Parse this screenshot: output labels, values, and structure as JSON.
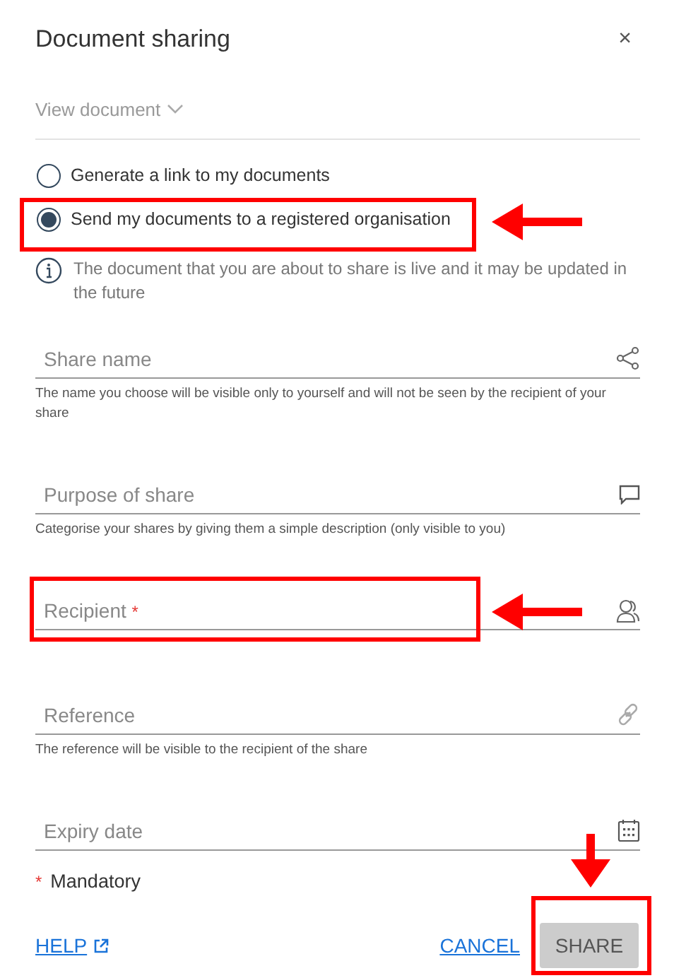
{
  "dialog": {
    "title": "Document sharing",
    "close": "×"
  },
  "view_document": "View document",
  "options": [
    {
      "label": "Generate a link to my documents",
      "selected": false
    },
    {
      "label": "Send my documents to a registered organisation",
      "selected": true
    }
  ],
  "info": "The document that you are about to share is live and it may be updated in the future",
  "fields": [
    {
      "kind": "share",
      "placeholder": "Share name",
      "helper": "The name you choose will be visible only to yourself and will not be seen by the recipient of your share"
    },
    {
      "kind": "comment",
      "placeholder": "Purpose of share",
      "helper": "Categorise your shares by giving them a simple description (only visible to you)"
    },
    {
      "kind": "person",
      "placeholder": "Recipient",
      "required_mark": "*"
    },
    {
      "kind": "link",
      "placeholder": "Reference",
      "helper": "The reference will be visible to the recipient of the share"
    },
    {
      "kind": "calendar",
      "placeholder": "Expiry date"
    }
  ],
  "mandatory": {
    "mark": "*",
    "text": "Mandatory"
  },
  "footer": {
    "help": "HELP",
    "cancel": "CANCEL",
    "share": {
      "label": "SHARE",
      "disabled": true
    }
  }
}
